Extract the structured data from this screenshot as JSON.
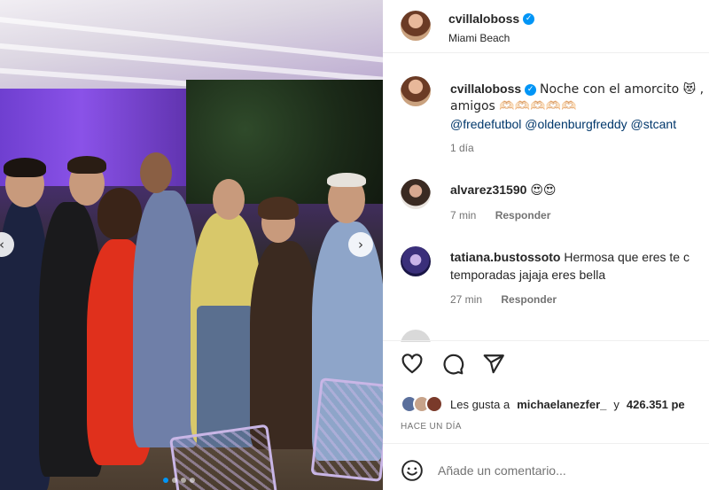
{
  "post": {
    "author": "cvillaloboss",
    "location": "Miami Beach",
    "carousel": {
      "total_slides": 4,
      "active_index": 0
    }
  },
  "caption": {
    "username": "cvillaloboss",
    "text": "Noche con el amorcito 😻 ,",
    "text2": "amigos 🫶🏻🫶🏻🫶🏻🫶🏻🫶🏻",
    "mentions": "@fredefutbol @oldenburgfreddy @stcant",
    "time": "1 día"
  },
  "comments": [
    {
      "username": "alvarez31590",
      "text": "😍😍",
      "time": "7 min",
      "reply": "Responder"
    },
    {
      "username": "tatiana.bustossoto",
      "text": "Hermosa que eres te c",
      "text2": "temporadas jajaja eres bella",
      "time": "27 min",
      "reply": "Responder"
    }
  ],
  "likes": {
    "prefix": "Les gusta a",
    "user": "michaelanezfer_",
    "middle": "y",
    "count": "426.351 pe"
  },
  "posted_ago": "HACE UN DÍA",
  "comment_input": {
    "placeholder": "Añade un comentario..."
  },
  "icons": {
    "like": "heart-icon",
    "comment": "comment-bubble-icon",
    "share": "paper-plane-icon",
    "emoji": "smiley-icon",
    "prev": "chevron-left-icon",
    "next": "chevron-right-icon"
  },
  "colors": {
    "accent": "#0095f6",
    "text": "#262626",
    "muted": "#737373",
    "mention": "#00376b"
  }
}
